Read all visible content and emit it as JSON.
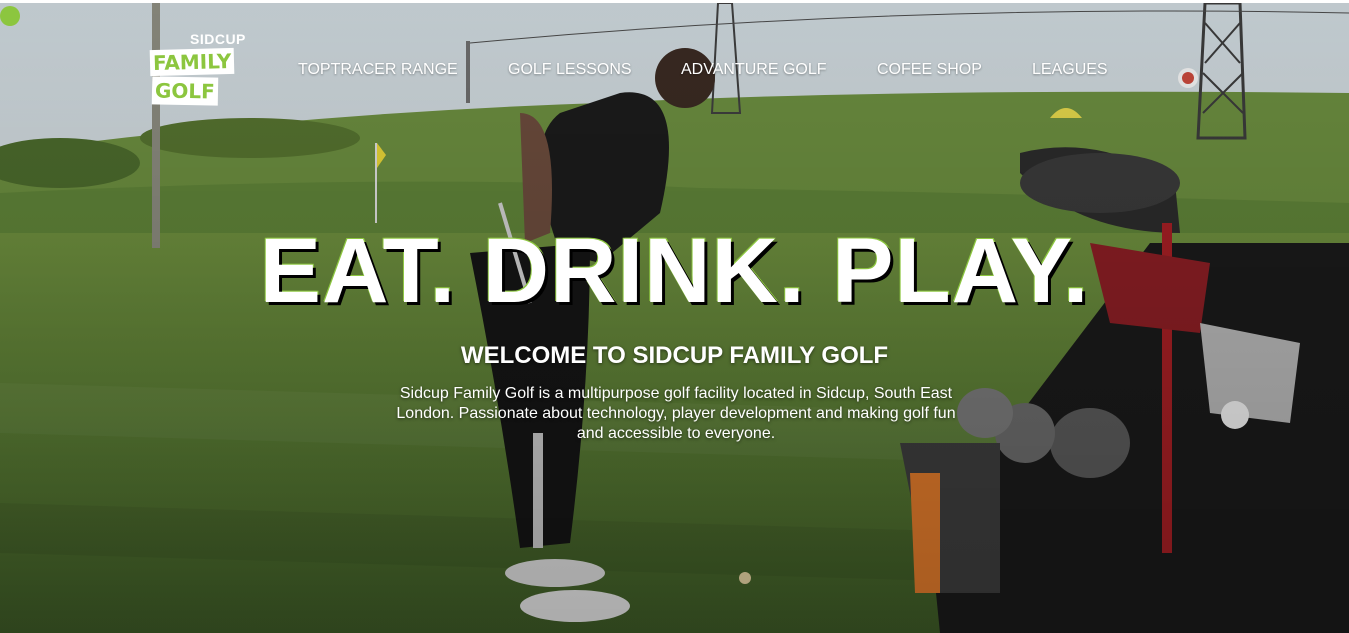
{
  "logo": {
    "line1": "SIDCUP",
    "line2": "FAMILY",
    "line3": "GOLF"
  },
  "nav": {
    "items": [
      "TOPTRACER RANGE",
      "GOLF LESSONS",
      "ADVANTURE GOLF",
      "COFEE SHOP",
      "LEAGUES"
    ]
  },
  "hero": {
    "headline": "EAT. DRINK. PLAY.",
    "subheading": "WELCOME TO SIDCUP FAMILY GOLF",
    "intro": "Sidcup Family Golf is a multipurpose golf facility located in Sidcup, South East London. Passionate about technology, player development and making golf fun and accessible to everyone."
  },
  "colors": {
    "brand_green": "#8cc63f",
    "text": "#ffffff",
    "grass": "#4f6b33",
    "sky": "#dfe6ea"
  }
}
